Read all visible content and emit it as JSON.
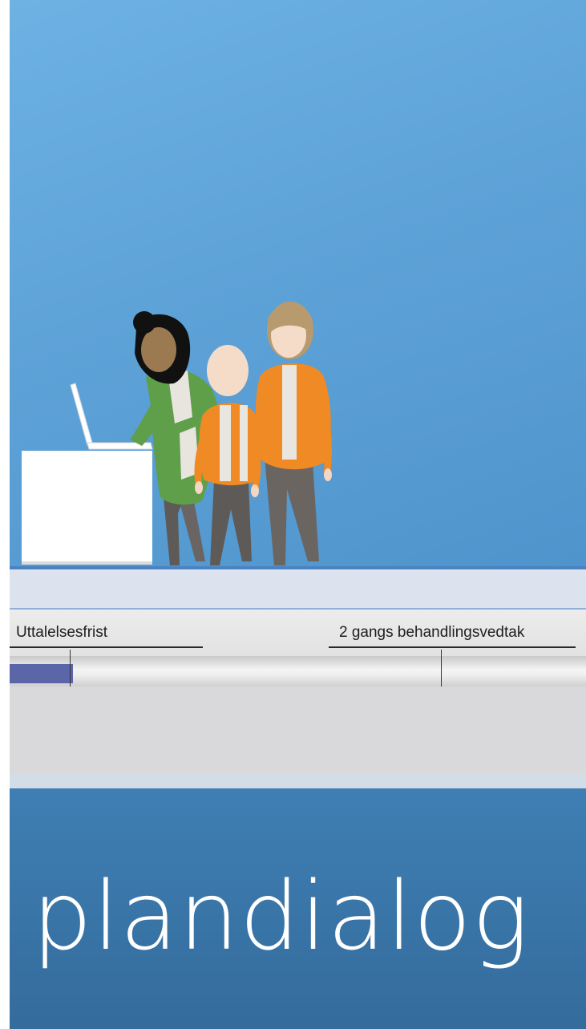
{
  "timeline": {
    "label_left": "Uttalelsesfrist",
    "label_right": "2 gangs behandlingsvedtak",
    "progress_percent": 11
  },
  "footer": {
    "title": "plandialog"
  },
  "colors": {
    "sky": "#5ea3d8",
    "progress": "#5a66a8",
    "footer": "#3a76a9",
    "vest_orange": "#f08a24",
    "jacket_green": "#5f9f4a"
  },
  "illustration": {
    "icons": [
      "desk",
      "laptop",
      "woman-green-jacket",
      "child-orange-vest",
      "woman-orange-vest"
    ]
  }
}
